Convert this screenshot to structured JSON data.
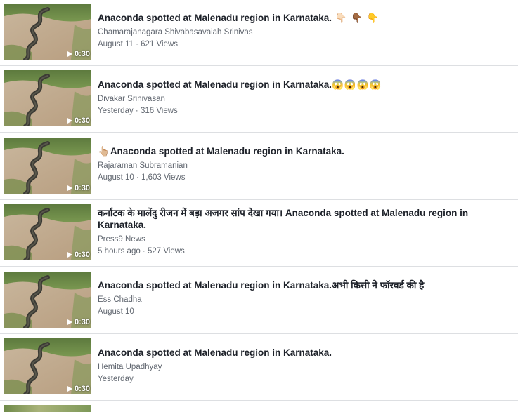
{
  "videos": [
    {
      "title": "Anaconda spotted at Malenadu region in Karnataka.",
      "emojis": " 👇🏻 👇🏾 👇",
      "author": "Chamarajanagara Shivabasavaiah Srinivas",
      "date": "August 11",
      "views": "621 Views",
      "duration": "0:30"
    },
    {
      "title": "Anaconda spotted at Malenadu region in Karnataka.",
      "emojis": "😱😱😱😱",
      "author": "Divakar Srinivasan",
      "date": "Yesterday",
      "views": "316 Views",
      "duration": "0:30"
    },
    {
      "title": "Anaconda spotted at Malenadu region in Karnataka.",
      "emojis_prefix": "👆🏼",
      "author": "Rajaraman Subramanian",
      "date": "August 10",
      "views": "1,603 Views",
      "duration": "0:30"
    },
    {
      "title": "कर्नाटक के मालेंदु रीजन में बड़ा अजगर सांप देखा गया।  Anaconda spotted at Malenadu region in Karnataka.",
      "author": "Press9 News",
      "date": "5 hours ago",
      "views": "527 Views",
      "duration": "0:30"
    },
    {
      "title": "Anaconda spotted at Malenadu region in Karnataka.अभी किसी ने फॉरवर्ड की है",
      "author": "Ess Chadha",
      "date": "August 10",
      "views": "",
      "duration": "0:30"
    },
    {
      "title": "Anaconda spotted at Malenadu region in Karnataka.",
      "author": "Hemita Upadhyay",
      "date": "Yesterday",
      "views": "",
      "duration": "0:30"
    }
  ],
  "separator": " · ",
  "colors": {
    "title": "#1d2129",
    "meta": "#616770",
    "divider": "#dddfe2"
  },
  "icons": {
    "play": "play-icon"
  }
}
